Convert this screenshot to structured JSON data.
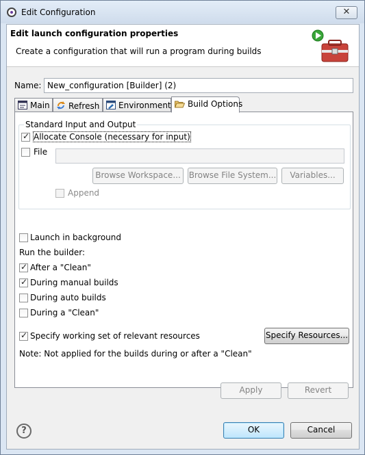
{
  "window": {
    "title": "Edit Configuration",
    "close_glyph": "✕"
  },
  "header": {
    "title": "Edit launch configuration properties",
    "message": "Create a configuration that will run a program during builds"
  },
  "name_field": {
    "label": "Name:",
    "value": "New_configuration [Builder] (2)"
  },
  "tabs": [
    {
      "label": "Main",
      "icon": "main-tab-icon"
    },
    {
      "label": "Refresh",
      "icon": "refresh-icon"
    },
    {
      "label": "Environment",
      "icon": "environment-icon"
    },
    {
      "label": "Build Options",
      "icon": "folder-open-icon",
      "active": true
    }
  ],
  "build_options": {
    "group_label": "Standard Input and Output",
    "allocate_console": {
      "label": "Allocate Console (necessary for input)",
      "checked": true
    },
    "file": {
      "label": "File",
      "checked": false,
      "value": ""
    },
    "browse_workspace": "Browse Workspace...",
    "browse_file_system": "Browse File System...",
    "variables": "Variables...",
    "append": {
      "label": "Append",
      "checked": false
    },
    "launch_background": {
      "label": "Launch in background",
      "checked": false
    },
    "run_builder_label": "Run the builder:",
    "after_clean": {
      "label": "After a \"Clean\"",
      "checked": true
    },
    "manual_builds": {
      "label": "During manual builds",
      "checked": true
    },
    "auto_builds": {
      "label": "During auto builds",
      "checked": false
    },
    "during_clean": {
      "label": "During a \"Clean\"",
      "checked": false
    },
    "working_set": {
      "label": "Specify working set of relevant resources",
      "checked": true
    },
    "specify_resources": "Specify Resources...",
    "note": "Note: Not applied for the builds during or after a \"Clean\""
  },
  "panel_buttons": {
    "apply": "Apply",
    "revert": "Revert"
  },
  "dialog_buttons": {
    "help": "?",
    "ok": "OK",
    "cancel": "Cancel"
  },
  "colors": {
    "accent": "#3c7fb1",
    "title_bar": "#cfdcec"
  }
}
